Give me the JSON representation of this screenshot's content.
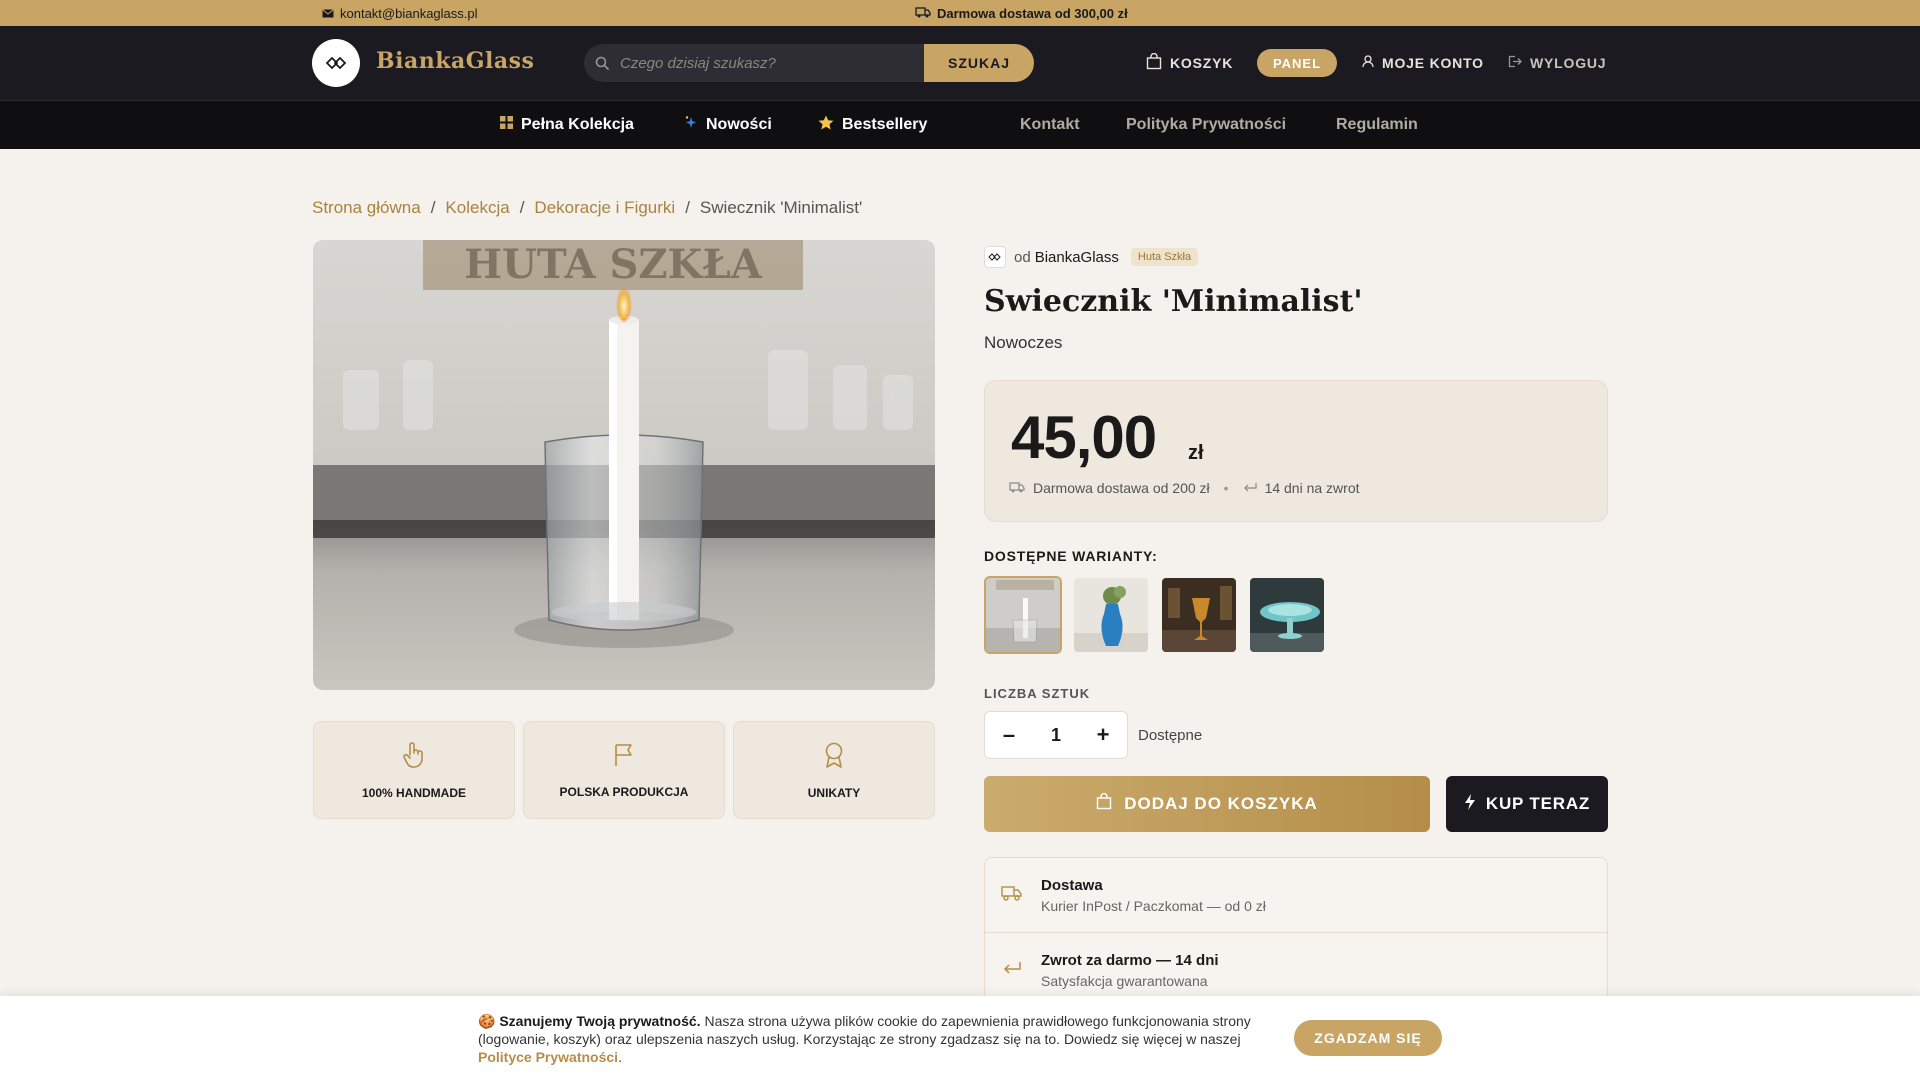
{
  "topbar": {
    "email": "kontakt@biankaglass.pl",
    "shipping": "Darmowa dostawa od 300,00 zł"
  },
  "header": {
    "logo": "BiankaGlass",
    "search_placeholder": "Czego dzisiaj szukasz?",
    "search_button": "SZUKAJ",
    "cart": "KOSZYK",
    "panel": "PANEL",
    "account": "MOJE KONTO",
    "logout": "WYLOGUJ"
  },
  "nav": {
    "full_collection": "Pełna Kolekcja",
    "new": "Nowości",
    "bestsellers": "Bestsellery",
    "contact": "Kontakt",
    "privacy": "Polityka Prywatności",
    "terms": "Regulamin"
  },
  "breadcrumb": {
    "home": "Strona główna",
    "collection": "Kolekcja",
    "category": "Dekoracje i Figurki",
    "current": "Swiecznik 'Minimalist'",
    "sep": "/"
  },
  "features": [
    {
      "label": "100% HANDMADE",
      "icon": "hand-icon"
    },
    {
      "label": "POLSKA PRODUKCJA",
      "icon": "flag-icon"
    },
    {
      "label": "UNIKATY",
      "icon": "award-icon"
    }
  ],
  "product": {
    "vendor_prefix": "od",
    "vendor": "BiankaGlass",
    "vendor_badge": "Huta Szkła",
    "title": "Swiecznik 'Minimalist'",
    "subtitle": "Nowoczes",
    "price": "45,00",
    "currency": "zł",
    "free_shipping": "Darmowa dostawa od 200 zł",
    "returns": "14 dni na zwrot",
    "variants_label": "DOSTĘPNE WARIANTY:",
    "qty_label": "LICZBA SZTUK",
    "qty": "1",
    "availability": "Dostępne",
    "add_to_cart": "DODAJ DO KOSZYKA",
    "buy_now": "KUP TERAZ",
    "image_text": "HUTA SZKŁA"
  },
  "info": [
    {
      "title": "Dostawa",
      "sub": "Kurier InPost / Paczkomat — od 0 zł"
    },
    {
      "title": "Zwrot za darmo — 14 dni",
      "sub": "Satysfakcja gwarantowana"
    }
  ],
  "cookie": {
    "emoji": "🍪",
    "title": "Szanujemy Twoją prywatność.",
    "text": "Nasza strona używa plików cookie do zapewnienia prawidłowego funkcjonowania strony (logowanie, koszyk) oraz ulepszenia naszych usług. Korzystając ze strony zgadzasz się na to. Dowiedz się więcej w naszej",
    "link": "Polityce Prywatności",
    "accept": "ZGADZAM SIĘ"
  },
  "colors": {
    "gold": "#c8a465",
    "dark": "#1b1a20",
    "bg": "#f5f1ec"
  }
}
